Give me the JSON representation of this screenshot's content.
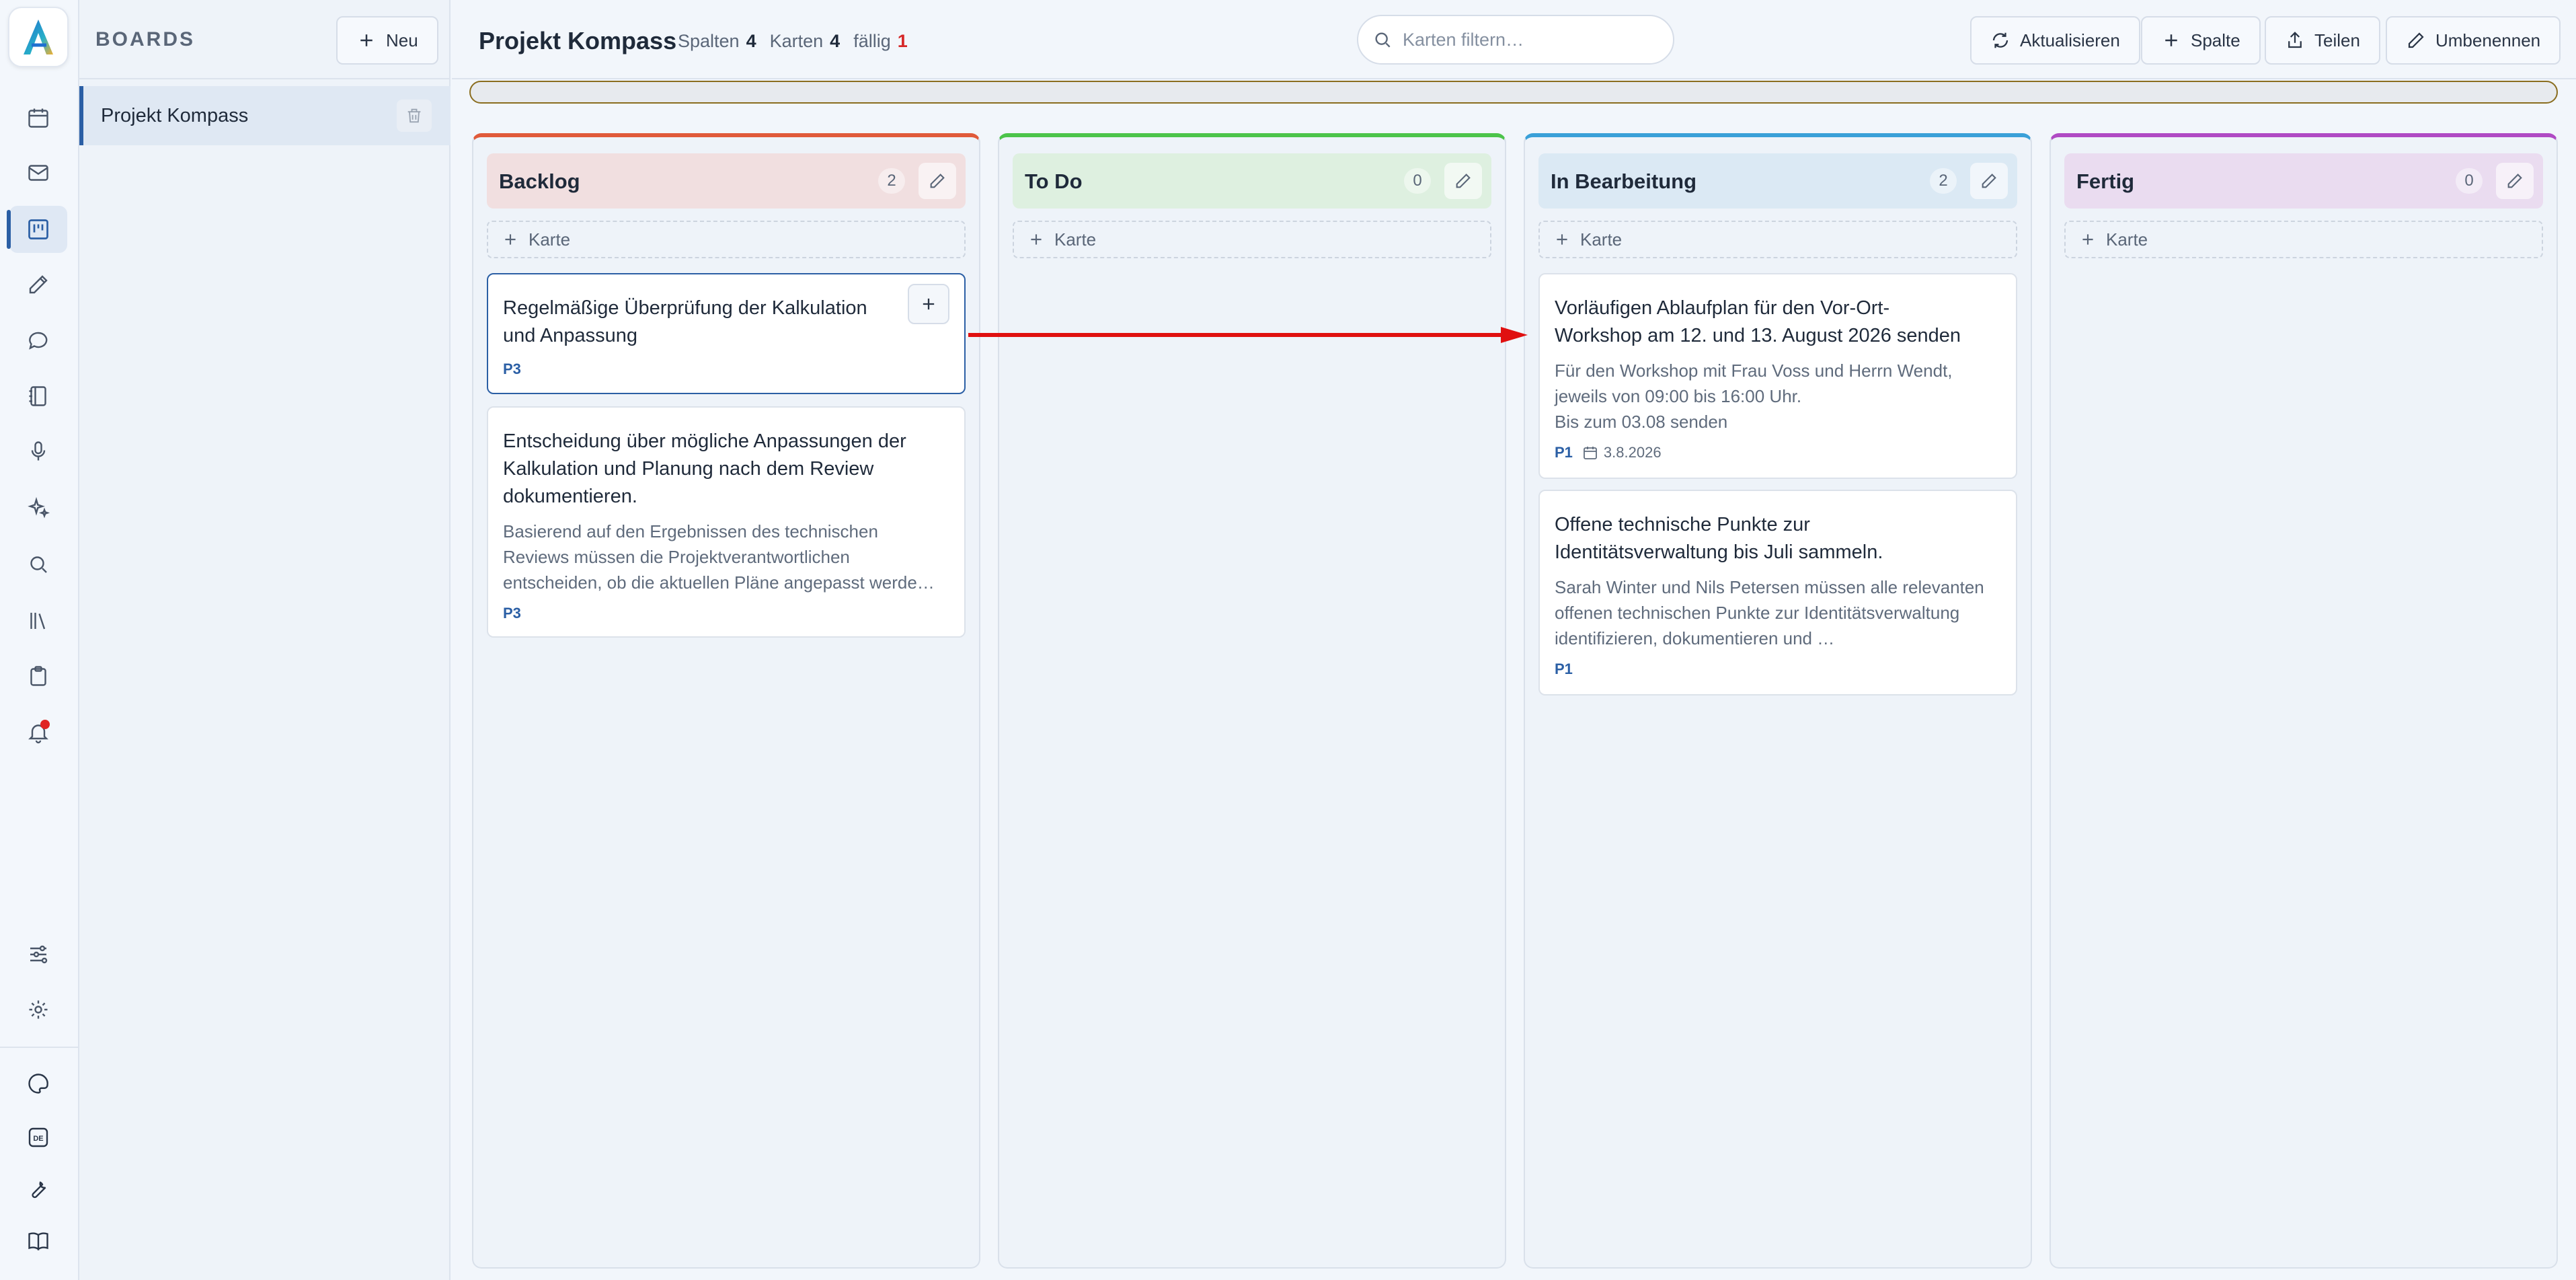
{
  "colors": {
    "accent": "#2b5fa5",
    "due_red": "#d62828",
    "col_backlog": "#e05a3a",
    "col_todo": "#4cc44a",
    "col_inprogress": "#3aa0d8",
    "col_done": "#b04ac4",
    "arrow": "#e01010"
  },
  "rail": {
    "logo_icon": "app-logo-a",
    "items": [
      "calendar-icon",
      "mail-icon",
      "kanban-icon",
      "edit-icon",
      "chat-icon",
      "notebook-icon",
      "microphone-icon",
      "sparkles-icon",
      "search-icon",
      "library-icon",
      "clipboard-icon",
      "bell-icon"
    ],
    "bottom": [
      "sliders-icon",
      "gear-icon",
      "palette-icon",
      "language-de-icon",
      "wrench-icon",
      "book-icon"
    ],
    "language_badge": "DE"
  },
  "boards": {
    "title": "BOARDS",
    "new_label": "Neu",
    "items": [
      {
        "label": "Projekt Kompass"
      }
    ]
  },
  "topbar": {
    "title": "Projekt Kompass",
    "stats": {
      "columns_label": "Spalten",
      "columns_value": "4",
      "cards_label": "Karten",
      "cards_value": "4",
      "due_label": "fällig",
      "due_value": "1"
    },
    "search_placeholder": "Karten filtern…",
    "refresh_label": "Aktualisieren",
    "column_label": "Spalte",
    "share_label": "Teilen",
    "rename_label": "Umbenennen"
  },
  "columns": [
    {
      "name": "Backlog",
      "count": "2",
      "add_label": "Karte",
      "cards": [
        {
          "title": "Regelmäßige Überprüfung der Kalkulation und Anpassung",
          "desc": "",
          "priority": "P3",
          "date": ""
        },
        {
          "title": "Entscheidung über mögliche Anpassungen der Kalkulation und Planung nach dem Review dokumentieren.",
          "desc": "Basierend auf den Ergebnissen des technischen Reviews müssen die Projektverantwortlichen entscheiden, ob die aktuellen Pläne angepasst werde…",
          "priority": "P3",
          "date": ""
        }
      ]
    },
    {
      "name": "To Do",
      "count": "0",
      "add_label": "Karte",
      "cards": []
    },
    {
      "name": "In Bearbeitung",
      "count": "2",
      "add_label": "Karte",
      "cards": [
        {
          "title": "Vorläufigen Ablaufplan für den Vor-Ort-Workshop am 12. und 13. August 2026 senden",
          "desc": "Für den Workshop mit Frau Voss und Herrn Wendt, jeweils von 09:00 bis 16:00 Uhr.\nBis zum 03.08 senden",
          "priority": "P1",
          "date": "3.8.2026"
        },
        {
          "title": "Offene technische Punkte zur Identitätsverwaltung bis Juli sammeln.",
          "desc": "Sarah Winter und Nils Petersen müssen alle relevanten offenen technischen Punkte zur Identitätsverwaltung identifizieren, dokumentieren und …",
          "priority": "P1",
          "date": ""
        }
      ]
    },
    {
      "name": "Fertig",
      "count": "0",
      "add_label": "Karte",
      "cards": []
    }
  ]
}
